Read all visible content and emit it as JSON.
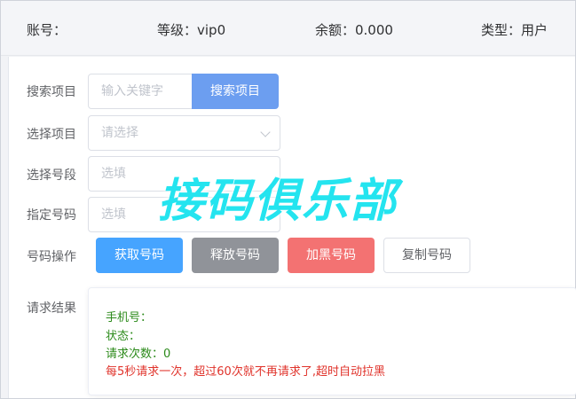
{
  "header": {
    "account_label": "账号：",
    "level_label": "等级：vip0",
    "balance_label": "余额：0.000",
    "type_label": "类型：用户"
  },
  "form": {
    "search_project": {
      "label": "搜索项目",
      "placeholder": "输入关键字",
      "button": "搜索项目"
    },
    "select_project": {
      "label": "选择项目",
      "placeholder": "请选择"
    },
    "select_segment": {
      "label": "选择号段",
      "placeholder": "选填"
    },
    "specify_number": {
      "label": "指定号码",
      "placeholder": "选填"
    },
    "number_ops": {
      "label": "号码操作",
      "get": "获取号码",
      "release": "释放号码",
      "blacklist": "加黑号码",
      "copy": "复制号码"
    },
    "result": {
      "label": "请求结果",
      "phone": "手机号：",
      "status": "状态：",
      "request_count": "请求次数：0",
      "notice": "每5秒请求一次，超过60次就不再请求了,超时自动拉黑"
    }
  },
  "watermark": "接码俱乐部",
  "colors": {
    "primary": "#409eff",
    "info": "#909399",
    "danger": "#f56c6c",
    "success_text": "#2b8a1a",
    "warning_text": "#e0332b",
    "watermark": "#19e3ef"
  }
}
